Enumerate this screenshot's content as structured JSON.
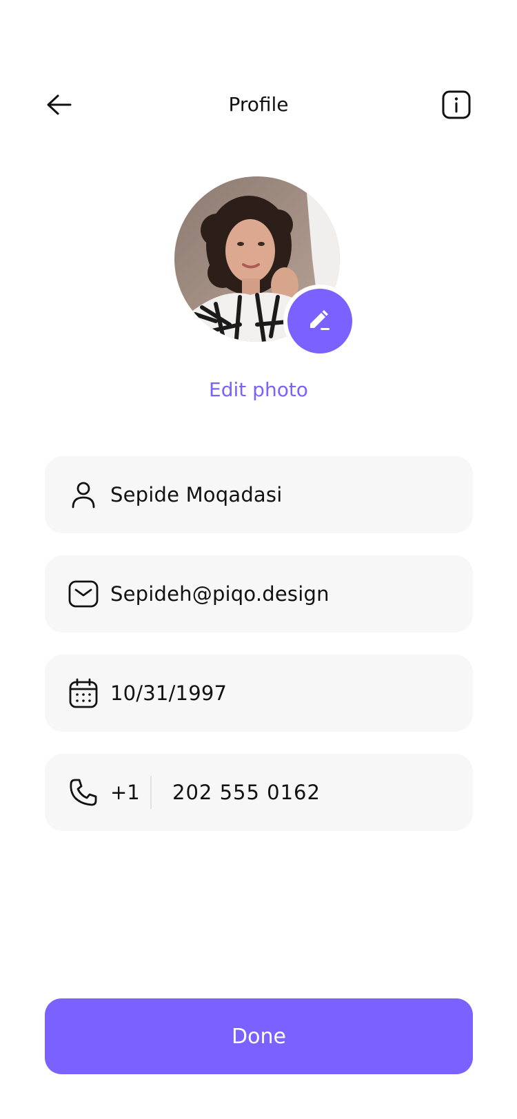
{
  "header": {
    "title": "Profile",
    "back_icon": "arrow-left-icon",
    "info_icon": "info-icon"
  },
  "profile": {
    "edit_badge_icon": "pencil-icon",
    "edit_photo_label": "Edit photo"
  },
  "fields": {
    "name": {
      "icon": "user-icon",
      "value": "Sepide Moqadasi"
    },
    "email": {
      "icon": "mail-icon",
      "value": "Sepideh@piqo.design"
    },
    "birthdate": {
      "icon": "calendar-icon",
      "value": "10/31/1997"
    },
    "phone": {
      "icon": "phone-icon",
      "country_code": "+1",
      "number": "202 555 0162"
    }
  },
  "actions": {
    "done_label": "Done"
  },
  "colors": {
    "accent": "#7b61ff",
    "field_bg": "#f7f7f7",
    "text": "#111111"
  }
}
